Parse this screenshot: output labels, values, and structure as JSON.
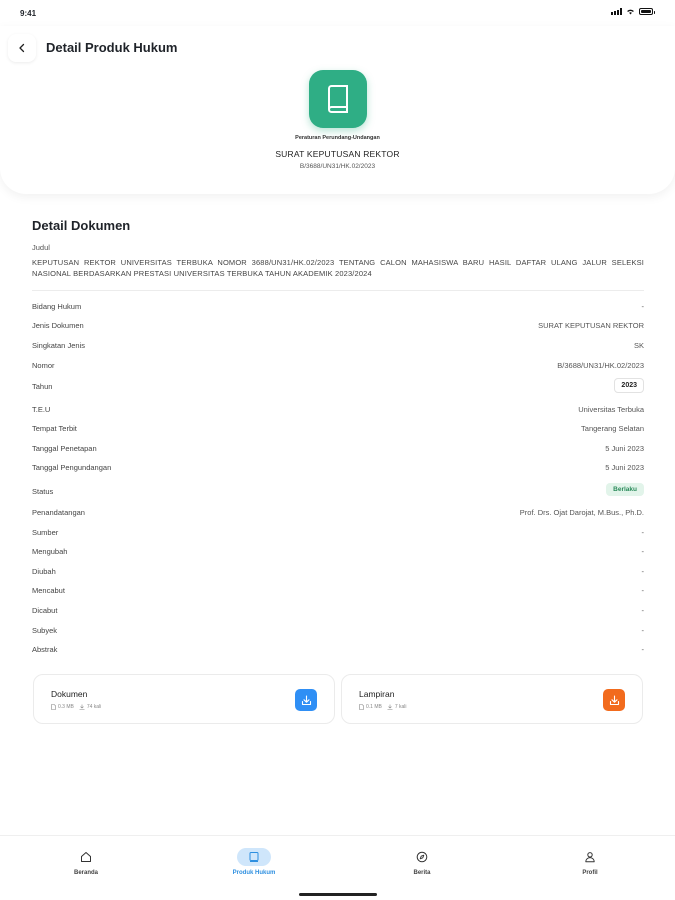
{
  "status_bar": {
    "time": "9:41"
  },
  "header": {
    "title": "Detail Produk Hukum",
    "category": "Peraturan Perundang-Undangan",
    "doc_type": "SURAT KEPUTUSAN REKTOR",
    "doc_number": "B/3688/UN31/HK.02/2023"
  },
  "detail": {
    "section_title": "Detail Dokumen",
    "judul_label": "Judul",
    "judul_text": "KEPUTUSAN REKTOR UNIVERSITAS TERBUKA NOMOR 3688/UN31/HK.02/2023 TENTANG CALON MAHASISWA BARU HASIL DAFTAR ULANG JALUR SELEKSI NASIONAL BERDASARKAN PRESTASI UNIVERSITAS TERBUKA TAHUN AKADEMIK 2023/2024",
    "rows": [
      {
        "label": "Bidang Hukum",
        "value": "-"
      },
      {
        "label": "Jenis Dokumen",
        "value": "SURAT KEPUTUSAN REKTOR"
      },
      {
        "label": "Singkatan Jenis",
        "value": "SK"
      },
      {
        "label": "Nomor",
        "value": "B/3688/UN31/HK.02/2023"
      },
      {
        "label": "Tahun",
        "value": "2023"
      },
      {
        "label": "T.E.U",
        "value": "Universitas Terbuka"
      },
      {
        "label": "Tempat Terbit",
        "value": "Tangerang Selatan"
      },
      {
        "label": "Tanggal Penetapan",
        "value": "5 Juni 2023"
      },
      {
        "label": "Tanggal Pengundangan",
        "value": "5 Juni 2023"
      },
      {
        "label": "Status",
        "value": "Berlaku"
      },
      {
        "label": "Penandatangan",
        "value": "Prof. Drs. Ojat Darojat, M.Bus., Ph.D."
      },
      {
        "label": "Sumber",
        "value": "-"
      },
      {
        "label": "Mengubah",
        "value": "-"
      },
      {
        "label": "Diubah",
        "value": "-"
      },
      {
        "label": "Mencabut",
        "value": "-"
      },
      {
        "label": "Dicabut",
        "value": "-"
      },
      {
        "label": "Subyek",
        "value": "-"
      },
      {
        "label": "Abstrak",
        "value": "-"
      }
    ]
  },
  "files": [
    {
      "title": "Dokumen",
      "size": "0.3 MB",
      "downloads": "74 kali",
      "button_color": "#2f8ff5"
    },
    {
      "title": "Lampiran",
      "size": "0.1 MB",
      "downloads": "7 kali",
      "button_color": "#f26b1d"
    }
  ],
  "nav": {
    "items": [
      {
        "label": "Beranda",
        "icon": "home-icon"
      },
      {
        "label": "Produk Hukum",
        "icon": "book-icon",
        "active": true
      },
      {
        "label": "Berita",
        "icon": "compass-icon"
      },
      {
        "label": "Profil",
        "icon": "user-icon"
      }
    ]
  },
  "colors": {
    "accent": "#2d8fe0",
    "book": "#2fae85",
    "status_bg": "#e2f4ea"
  }
}
